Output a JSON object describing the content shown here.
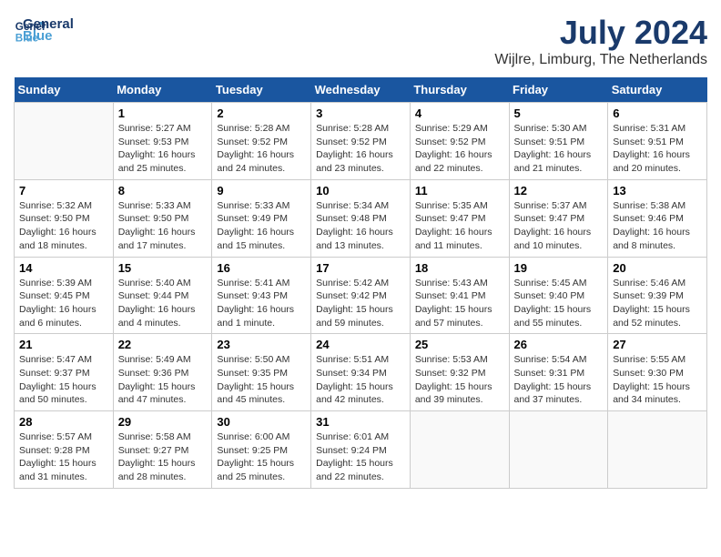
{
  "header": {
    "logo_general": "General",
    "logo_blue": "Blue",
    "month_year": "July 2024",
    "location": "Wijlre, Limburg, The Netherlands"
  },
  "days_of_week": [
    "Sunday",
    "Monday",
    "Tuesday",
    "Wednesday",
    "Thursday",
    "Friday",
    "Saturday"
  ],
  "weeks": [
    [
      {
        "day": "",
        "sunrise": "",
        "sunset": "",
        "daylight": ""
      },
      {
        "day": "1",
        "sunrise": "Sunrise: 5:27 AM",
        "sunset": "Sunset: 9:53 PM",
        "daylight": "Daylight: 16 hours and 25 minutes."
      },
      {
        "day": "2",
        "sunrise": "Sunrise: 5:28 AM",
        "sunset": "Sunset: 9:52 PM",
        "daylight": "Daylight: 16 hours and 24 minutes."
      },
      {
        "day": "3",
        "sunrise": "Sunrise: 5:28 AM",
        "sunset": "Sunset: 9:52 PM",
        "daylight": "Daylight: 16 hours and 23 minutes."
      },
      {
        "day": "4",
        "sunrise": "Sunrise: 5:29 AM",
        "sunset": "Sunset: 9:52 PM",
        "daylight": "Daylight: 16 hours and 22 minutes."
      },
      {
        "day": "5",
        "sunrise": "Sunrise: 5:30 AM",
        "sunset": "Sunset: 9:51 PM",
        "daylight": "Daylight: 16 hours and 21 minutes."
      },
      {
        "day": "6",
        "sunrise": "Sunrise: 5:31 AM",
        "sunset": "Sunset: 9:51 PM",
        "daylight": "Daylight: 16 hours and 20 minutes."
      }
    ],
    [
      {
        "day": "7",
        "sunrise": "Sunrise: 5:32 AM",
        "sunset": "Sunset: 9:50 PM",
        "daylight": "Daylight: 16 hours and 18 minutes."
      },
      {
        "day": "8",
        "sunrise": "Sunrise: 5:33 AM",
        "sunset": "Sunset: 9:50 PM",
        "daylight": "Daylight: 16 hours and 17 minutes."
      },
      {
        "day": "9",
        "sunrise": "Sunrise: 5:33 AM",
        "sunset": "Sunset: 9:49 PM",
        "daylight": "Daylight: 16 hours and 15 minutes."
      },
      {
        "day": "10",
        "sunrise": "Sunrise: 5:34 AM",
        "sunset": "Sunset: 9:48 PM",
        "daylight": "Daylight: 16 hours and 13 minutes."
      },
      {
        "day": "11",
        "sunrise": "Sunrise: 5:35 AM",
        "sunset": "Sunset: 9:47 PM",
        "daylight": "Daylight: 16 hours and 11 minutes."
      },
      {
        "day": "12",
        "sunrise": "Sunrise: 5:37 AM",
        "sunset": "Sunset: 9:47 PM",
        "daylight": "Daylight: 16 hours and 10 minutes."
      },
      {
        "day": "13",
        "sunrise": "Sunrise: 5:38 AM",
        "sunset": "Sunset: 9:46 PM",
        "daylight": "Daylight: 16 hours and 8 minutes."
      }
    ],
    [
      {
        "day": "14",
        "sunrise": "Sunrise: 5:39 AM",
        "sunset": "Sunset: 9:45 PM",
        "daylight": "Daylight: 16 hours and 6 minutes."
      },
      {
        "day": "15",
        "sunrise": "Sunrise: 5:40 AM",
        "sunset": "Sunset: 9:44 PM",
        "daylight": "Daylight: 16 hours and 4 minutes."
      },
      {
        "day": "16",
        "sunrise": "Sunrise: 5:41 AM",
        "sunset": "Sunset: 9:43 PM",
        "daylight": "Daylight: 16 hours and 1 minute."
      },
      {
        "day": "17",
        "sunrise": "Sunrise: 5:42 AM",
        "sunset": "Sunset: 9:42 PM",
        "daylight": "Daylight: 15 hours and 59 minutes."
      },
      {
        "day": "18",
        "sunrise": "Sunrise: 5:43 AM",
        "sunset": "Sunset: 9:41 PM",
        "daylight": "Daylight: 15 hours and 57 minutes."
      },
      {
        "day": "19",
        "sunrise": "Sunrise: 5:45 AM",
        "sunset": "Sunset: 9:40 PM",
        "daylight": "Daylight: 15 hours and 55 minutes."
      },
      {
        "day": "20",
        "sunrise": "Sunrise: 5:46 AM",
        "sunset": "Sunset: 9:39 PM",
        "daylight": "Daylight: 15 hours and 52 minutes."
      }
    ],
    [
      {
        "day": "21",
        "sunrise": "Sunrise: 5:47 AM",
        "sunset": "Sunset: 9:37 PM",
        "daylight": "Daylight: 15 hours and 50 minutes."
      },
      {
        "day": "22",
        "sunrise": "Sunrise: 5:49 AM",
        "sunset": "Sunset: 9:36 PM",
        "daylight": "Daylight: 15 hours and 47 minutes."
      },
      {
        "day": "23",
        "sunrise": "Sunrise: 5:50 AM",
        "sunset": "Sunset: 9:35 PM",
        "daylight": "Daylight: 15 hours and 45 minutes."
      },
      {
        "day": "24",
        "sunrise": "Sunrise: 5:51 AM",
        "sunset": "Sunset: 9:34 PM",
        "daylight": "Daylight: 15 hours and 42 minutes."
      },
      {
        "day": "25",
        "sunrise": "Sunrise: 5:53 AM",
        "sunset": "Sunset: 9:32 PM",
        "daylight": "Daylight: 15 hours and 39 minutes."
      },
      {
        "day": "26",
        "sunrise": "Sunrise: 5:54 AM",
        "sunset": "Sunset: 9:31 PM",
        "daylight": "Daylight: 15 hours and 37 minutes."
      },
      {
        "day": "27",
        "sunrise": "Sunrise: 5:55 AM",
        "sunset": "Sunset: 9:30 PM",
        "daylight": "Daylight: 15 hours and 34 minutes."
      }
    ],
    [
      {
        "day": "28",
        "sunrise": "Sunrise: 5:57 AM",
        "sunset": "Sunset: 9:28 PM",
        "daylight": "Daylight: 15 hours and 31 minutes."
      },
      {
        "day": "29",
        "sunrise": "Sunrise: 5:58 AM",
        "sunset": "Sunset: 9:27 PM",
        "daylight": "Daylight: 15 hours and 28 minutes."
      },
      {
        "day": "30",
        "sunrise": "Sunrise: 6:00 AM",
        "sunset": "Sunset: 9:25 PM",
        "daylight": "Daylight: 15 hours and 25 minutes."
      },
      {
        "day": "31",
        "sunrise": "Sunrise: 6:01 AM",
        "sunset": "Sunset: 9:24 PM",
        "daylight": "Daylight: 15 hours and 22 minutes."
      },
      {
        "day": "",
        "sunrise": "",
        "sunset": "",
        "daylight": ""
      },
      {
        "day": "",
        "sunrise": "",
        "sunset": "",
        "daylight": ""
      },
      {
        "day": "",
        "sunrise": "",
        "sunset": "",
        "daylight": ""
      }
    ]
  ]
}
